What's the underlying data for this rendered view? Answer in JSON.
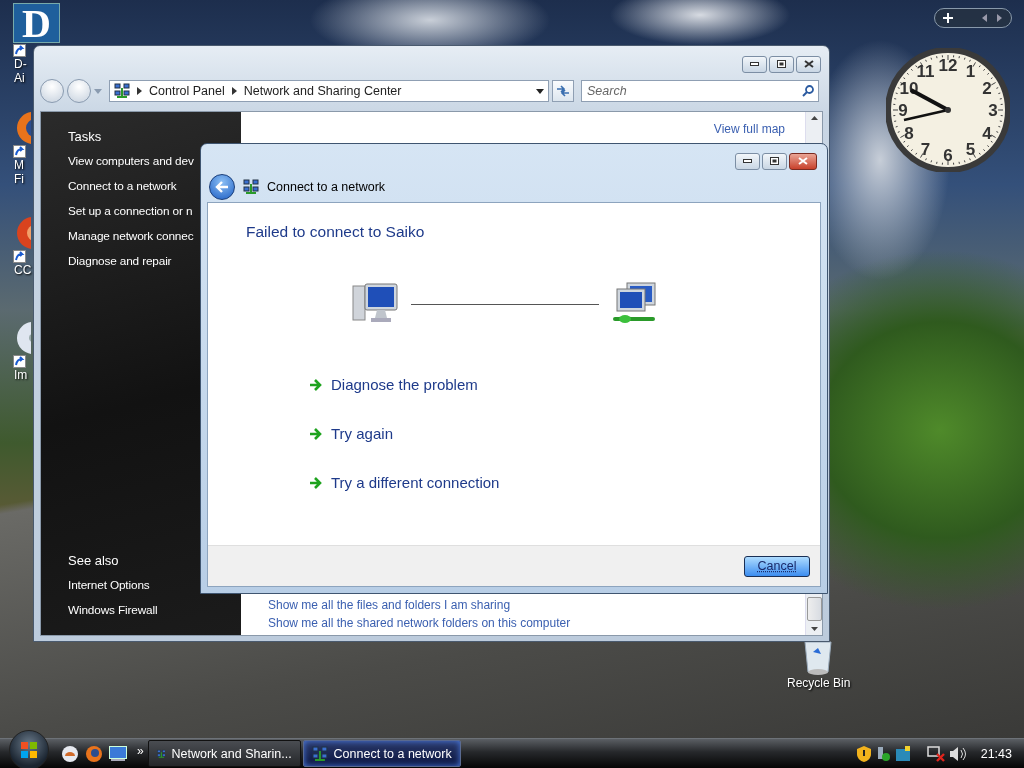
{
  "desktop_icons": [
    {
      "kind": "logo",
      "glyph": "D",
      "lines": [
        "D-",
        "Ai"
      ]
    },
    {
      "kind": "browser",
      "lines": [
        "M",
        "Fi"
      ]
    },
    {
      "kind": "app",
      "lines": [
        "CC"
      ]
    },
    {
      "kind": "disc",
      "lines": [
        "Im"
      ]
    }
  ],
  "recycle_bin": {
    "label": "Recycle Bin"
  },
  "clock_gadget": {
    "numerals": [
      "12",
      "11",
      "1",
      "10",
      "2",
      "9",
      "3",
      "8",
      "4",
      "7",
      "5",
      "6"
    ]
  },
  "explorer_window": {
    "breadcrumbs": [
      "Control Panel",
      "Network and Sharing Center"
    ],
    "search": {
      "placeholder": "Search"
    },
    "tasks": {
      "heading": "Tasks",
      "items": [
        "View computers and dev",
        "Connect to a network",
        "Set up a connection or n",
        "Manage network connec",
        "Diagnose and repair"
      ]
    },
    "see_also": {
      "heading": "See also",
      "items": [
        "Internet Options",
        "Windows Firewall"
      ]
    },
    "map_link": "View full map",
    "links": [
      "Show me all the files and folders I am sharing",
      "Show me all the shared network folders on this computer"
    ]
  },
  "dialog": {
    "title": "Connect to a network",
    "heading": "Failed to connect to Saiko",
    "options": [
      "Diagnose the problem",
      "Try again",
      "Try a different connection"
    ],
    "buttons": [
      {
        "label": "Cancel",
        "default": true
      }
    ]
  },
  "taskbar": {
    "overflow": "»",
    "tasks": [
      {
        "label": "Network and Sharin...",
        "selected": false
      },
      {
        "label": "Connect to a network",
        "selected": true
      }
    ],
    "time": "21:43"
  }
}
